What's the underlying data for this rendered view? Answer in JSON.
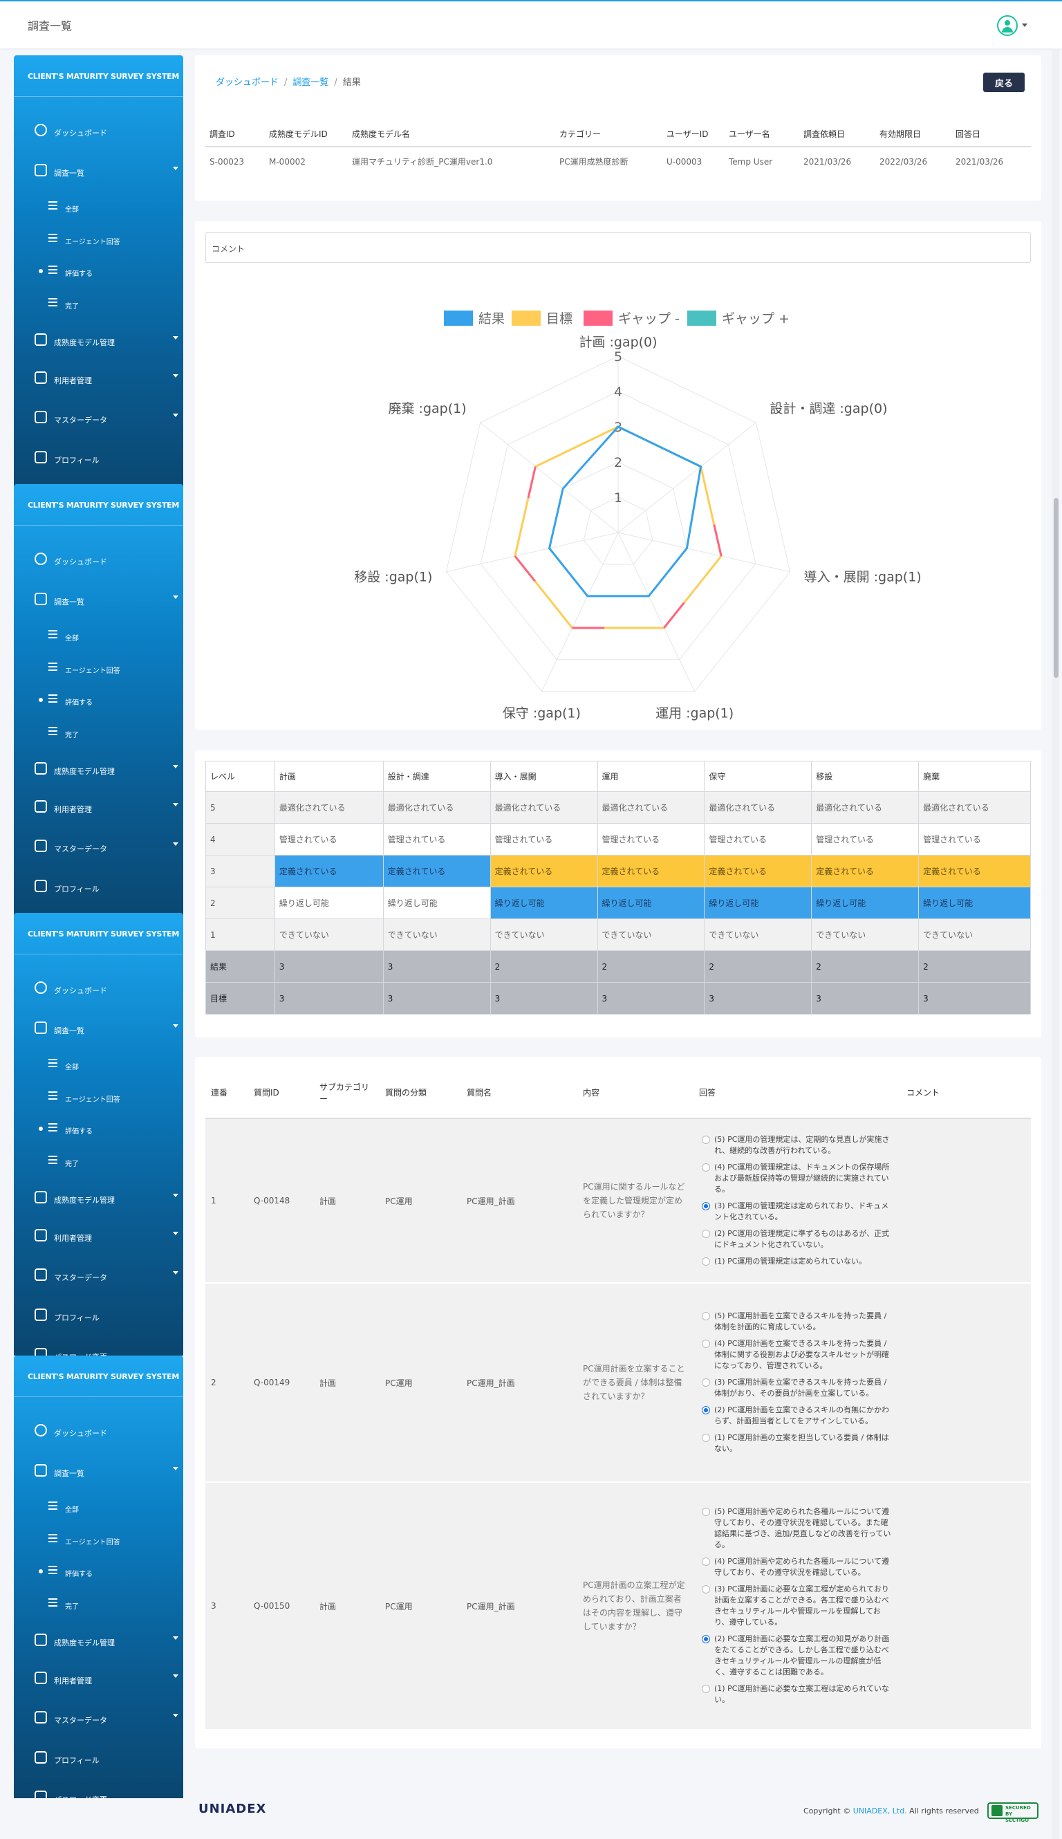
{
  "header": {
    "title": "調査一覧"
  },
  "sidebar": {
    "logo": "CLIENT'S MATURITY SURVEY SYSTEM",
    "items": {
      "dashboard": "ダッシュボード",
      "surveys": "調査一覧",
      "all": "全部",
      "agent_answer": "エージェント回答",
      "evaluate": "評価する",
      "done": "完了",
      "model_mgmt": "成熟度モデル管理",
      "user_mgmt": "利用者管理",
      "master": "マスターデータ",
      "profile": "プロフィール",
      "password": "パスワード変更"
    }
  },
  "breadcrumb": {
    "dashboard": "ダッシュボード",
    "surveys": "調査一覧",
    "current": "結果"
  },
  "back_label": "戻る",
  "info": {
    "headers": [
      "調査ID",
      "成熟度モデルID",
      "成熟度モデル名",
      "カテゴリー",
      "ユーザーID",
      "ユーザー名",
      "調査依頼日",
      "有効期限日",
      "回答日"
    ],
    "values": [
      "S-00023",
      "M-00002",
      "運用マチュリティ診断_PC運用ver1.0",
      "PC運用成熟度診断",
      "U-00003",
      "Temp User",
      "2021/03/26",
      "2022/03/26",
      "2021/03/26"
    ]
  },
  "comment_label": "コメント",
  "chart_data": {
    "type": "radar",
    "legend": [
      "結果",
      "目標",
      "ギャップ -",
      "ギャップ +"
    ],
    "colors": {
      "result": "#36a2eb",
      "target": "#ffcd56",
      "gap_minus": "#ff6384",
      "gap_plus": "#4bc0c0"
    },
    "axes": [
      "計画 :gap(0)",
      "設計・調達 :gap(0)",
      "導入・展開 :gap(1)",
      "運用 :gap(1)",
      "保守 :gap(1)",
      "移設 :gap(1)",
      "廃棄 :gap(1)"
    ],
    "ticks": [
      "1",
      "2",
      "3",
      "4",
      "5"
    ],
    "rmax": 5,
    "series": [
      {
        "name": "結果",
        "values": [
          3,
          3,
          2,
          2,
          2,
          2,
          2
        ]
      },
      {
        "name": "目標",
        "values": [
          3,
          3,
          3,
          3,
          3,
          3,
          3
        ]
      }
    ]
  },
  "levels": {
    "headers": [
      "レベル",
      "計画",
      "設計・調達",
      "導入・展開",
      "運用",
      "保守",
      "移設",
      "廃棄"
    ],
    "rows": [
      {
        "level": "5",
        "label": "最適化されている"
      },
      {
        "level": "4",
        "label": "管理されている"
      },
      {
        "level": "3",
        "label": "定義されている"
      },
      {
        "level": "2",
        "label": "繰り返し可能"
      },
      {
        "level": "1",
        "label": "できていない"
      }
    ],
    "result_label": "結果",
    "target_label": "目標",
    "results": [
      "3",
      "3",
      "2",
      "2",
      "2",
      "2",
      "2"
    ],
    "targets": [
      "3",
      "3",
      "3",
      "3",
      "3",
      "3",
      "3"
    ]
  },
  "questions": {
    "headers": [
      "連番",
      "質問ID",
      "サブカテゴリー",
      "質問の分類",
      "質問名",
      "内容",
      "回答",
      "コメント"
    ],
    "rows": [
      {
        "no": "1",
        "id": "Q-00148",
        "sub": "計画",
        "cls": "PC運用",
        "name": "PC運用_計画",
        "content": "PC運用に関するルールなどを定義した管理規定が定められていますか？",
        "options": [
          "(5) PC運用の管理規定は、定期的な見直しが実施され、継続的な改善が行われている。",
          "(4) PC運用の管理規定は、ドキュメントの保存場所および最新版保持等の管理が継続的に実施されている。",
          "(3) PC運用の管理規定は定められており、ドキュメント化されている。",
          "(2) PC運用の管理規定に準ずるものはあるが、正式にドキュメント化されていない。",
          "(1) PC運用の管理規定は定められていない。"
        ],
        "selected": 2
      },
      {
        "no": "2",
        "id": "Q-00149",
        "sub": "計画",
        "cls": "PC運用",
        "name": "PC運用_計画",
        "content": "PC運用計画を立案することができる要員 / 体制は整備されていますか？",
        "options": [
          "(5) PC運用計画を立案できるスキルを持った要員 / 体制を計画的に育成している。",
          "(4) PC運用計画を立案できるスキルを持った要員 / 体制に関する役割および必要なスキルセットが明確になっており、管理されている。",
          "(3) PC運用計画を立案できるスキルを持った要員 / 体制がおり、その要員が計画を立案している。",
          "(2) PC運用計画を立案できるスキルの有無にかかわらず、計画担当者としてをアサインしている。",
          "(1) PC運用計画の立案を担当している要員 / 体制はない。"
        ],
        "selected": 3
      },
      {
        "no": "3",
        "id": "Q-00150",
        "sub": "計画",
        "cls": "PC運用",
        "name": "PC運用_計画",
        "content": "PC運用計画の立案工程が定められており、計画立案者はその内容を理解し、遵守していますか？",
        "options": [
          "(5) PC運用計画や定められた各種ルールについて遵守しており、その遵守状況を確認している。また確認結果に基づき、追加/見直しなどの改善を行っている。",
          "(4) PC運用計画や定められた各種ルールについて遵守しており、その遵守状況を確認している。",
          "(3) PC運用計画に必要な立案工程が定められており計画を立案することができる。各工程で盛り込むべきセキュリティルールや管理ルールを理解しており、遵守している。",
          "(2) PC運用計画に必要な立案工程の知見があり計画をたてることができる。しかし各工程で盛り込むべきセキュリティルールや管理ルールの理解度が低く、遵守することは困難である。",
          "(1) PC運用計画に必要な立案工程は定められていない。"
        ],
        "selected": 3
      }
    ]
  },
  "footer": {
    "logo": "UNIADEX",
    "copy_prefix": "Copyright ©",
    "copy_company": "UNIADEX, Ltd.",
    "copy_suffix": "All rights reserved",
    "seal": "SECURED BY SECTIGO"
  }
}
